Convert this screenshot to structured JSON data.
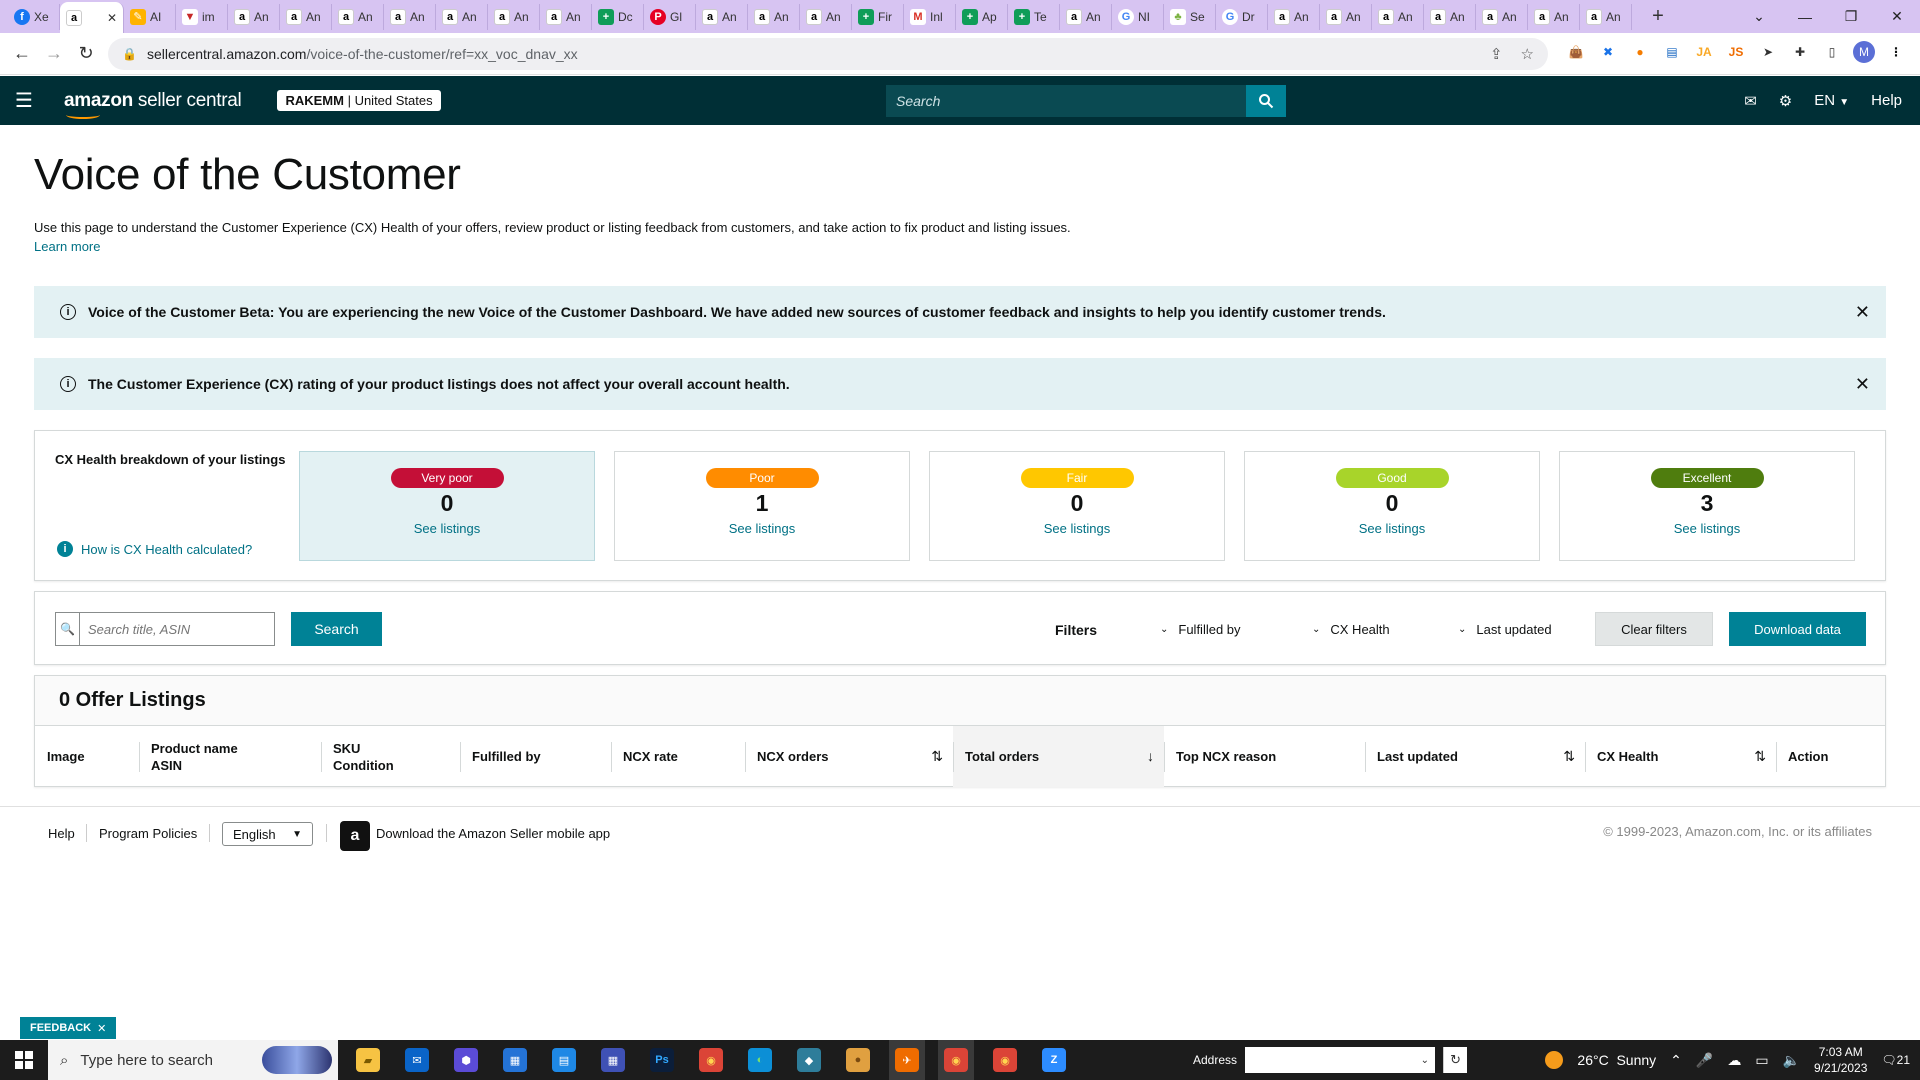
{
  "browser": {
    "tabs": [
      {
        "fav": "fb",
        "glyph": "f",
        "label": "Xe"
      },
      {
        "fav": "a",
        "glyph": "a",
        "label": "",
        "active": true
      },
      {
        "fav": "pen",
        "glyph": "✎",
        "label": "AI"
      },
      {
        "fav": "v",
        "glyph": "▼",
        "label": "im"
      },
      {
        "fav": "a",
        "glyph": "a",
        "label": "An"
      },
      {
        "fav": "a",
        "glyph": "a",
        "label": "An"
      },
      {
        "fav": "a",
        "glyph": "a",
        "label": "An"
      },
      {
        "fav": "a",
        "glyph": "a",
        "label": "An"
      },
      {
        "fav": "a",
        "glyph": "a",
        "label": "An"
      },
      {
        "fav": "a",
        "glyph": "a",
        "label": "An"
      },
      {
        "fav": "a",
        "glyph": "a",
        "label": "An"
      },
      {
        "fav": "sheet",
        "glyph": "+",
        "label": "Dc"
      },
      {
        "fav": "pin",
        "glyph": "P",
        "label": "Gl"
      },
      {
        "fav": "a",
        "glyph": "a",
        "label": "An"
      },
      {
        "fav": "a",
        "glyph": "a",
        "label": "An"
      },
      {
        "fav": "a",
        "glyph": "a",
        "label": "An"
      },
      {
        "fav": "sheet",
        "glyph": "+",
        "label": "Fir"
      },
      {
        "fav": "gm",
        "glyph": "M",
        "label": "Inl"
      },
      {
        "fav": "sheet",
        "glyph": "+",
        "label": "Ap"
      },
      {
        "fav": "sheet",
        "glyph": "+",
        "label": "Te"
      },
      {
        "fav": "a",
        "glyph": "a",
        "label": "An"
      },
      {
        "fav": "g",
        "glyph": "G",
        "label": "NI"
      },
      {
        "fav": "leaf",
        "glyph": "♣",
        "label": "Se"
      },
      {
        "fav": "g",
        "glyph": "G",
        "label": "Dr"
      },
      {
        "fav": "a",
        "glyph": "a",
        "label": "An"
      },
      {
        "fav": "a",
        "glyph": "a",
        "label": "An"
      },
      {
        "fav": "a",
        "glyph": "a",
        "label": "An"
      },
      {
        "fav": "a",
        "glyph": "a",
        "label": "An"
      },
      {
        "fav": "a",
        "glyph": "a",
        "label": "An"
      },
      {
        "fav": "a",
        "glyph": "a",
        "label": "An"
      },
      {
        "fav": "a",
        "glyph": "a",
        "label": "An"
      }
    ],
    "url_host": "sellercentral.amazon.com",
    "url_path": "/voice-of-the-customer/ref=xx_voc_dnav_xx",
    "profile_initial": "M",
    "extensions": [
      {
        "name": "bag",
        "glyph": "👜",
        "color": "#c47a2c"
      },
      {
        "name": "x-circle",
        "glyph": "✖",
        "color": "#1a73e8"
      },
      {
        "name": "orange",
        "glyph": "●",
        "color": "#f57c00"
      },
      {
        "name": "chart",
        "glyph": "▤",
        "color": "#1565c0"
      },
      {
        "name": "ja",
        "glyph": "JA",
        "color": "#f9a825"
      },
      {
        "name": "js",
        "glyph": "JS",
        "color": "#ef6c00"
      },
      {
        "name": "arrow",
        "glyph": "➤",
        "color": "#333"
      },
      {
        "name": "puzzle",
        "glyph": "✚",
        "color": "#333"
      },
      {
        "name": "sidepanel",
        "glyph": "▯",
        "color": "#333"
      }
    ]
  },
  "header": {
    "logo_bold": "amazon",
    "logo_light": " seller central",
    "store_name": "RAKEMM",
    "store_sep": " | ",
    "store_country": "United States",
    "search_placeholder": "Search",
    "language": "EN",
    "help": "Help"
  },
  "page": {
    "title": "Voice of the Customer",
    "intro": "Use this page to understand the Customer Experience (CX) Health of your offers, review product or listing feedback from customers, and take action to fix product and listing issues.",
    "learn_more": "Learn more"
  },
  "alerts": [
    "Voice of the Customer Beta: You are experiencing the new Voice of the Customer Dashboard. We have added new sources of customer feedback and insights to help you identify customer trends.",
    "The Customer Experience (CX) rating of your product listings does not affect your overall account health."
  ],
  "health": {
    "title": "CX Health breakdown of your listings",
    "link": "How is CX Health calculated?",
    "cards": [
      {
        "label": "Very poor",
        "count": "0",
        "link": "See listings",
        "color": "#c40f37",
        "text": "#ffffff",
        "selected": true
      },
      {
        "label": "Poor",
        "count": "1",
        "link": "See listings",
        "color": "#ff8c00",
        "text": "#ffffff",
        "selected": false
      },
      {
        "label": "Fair",
        "count": "0",
        "link": "See listings",
        "color": "#ffc700",
        "text": "#ffffff",
        "selected": false
      },
      {
        "label": "Good",
        "count": "0",
        "link": "See listings",
        "color": "#a8d42a",
        "text": "#ffffff",
        "selected": false
      },
      {
        "label": "Excellent",
        "count": "3",
        "link": "See listings",
        "color": "#4f7d0e",
        "text": "#ffffff",
        "selected": false
      }
    ]
  },
  "filters": {
    "search_placeholder": "Search title, ASIN",
    "search_button": "Search",
    "label": "Filters",
    "selects": [
      "Fulfilled by",
      "CX Health",
      "Last updated"
    ],
    "clear": "Clear filters",
    "download": "Download data"
  },
  "listings": {
    "title": "0 Offer Listings",
    "columns": [
      {
        "l1": "Image",
        "l2": ""
      },
      {
        "l1": "Product name",
        "l2": "ASIN"
      },
      {
        "l1": "SKU",
        "l2": "Condition"
      },
      {
        "l1": "Fulfilled by",
        "l2": ""
      },
      {
        "l1": "NCX rate",
        "l2": ""
      },
      {
        "l1": "NCX orders",
        "l2": "",
        "sort": "⇅"
      },
      {
        "l1": "Total orders",
        "l2": "",
        "sort": "↓",
        "active": true
      },
      {
        "l1": "Top NCX reason",
        "l2": ""
      },
      {
        "l1": "Last updated",
        "l2": "",
        "sort": "⇅"
      },
      {
        "l1": "CX Health",
        "l2": "",
        "sort": "⇅"
      },
      {
        "l1": "Action",
        "l2": ""
      }
    ]
  },
  "footer": {
    "help": "Help",
    "policies": "Program Policies",
    "language": "English",
    "app_text": "Download the Amazon Seller mobile app",
    "copyright": "© 1999-2023, Amazon.com, Inc. or its affiliates"
  },
  "feedback": "FEEDBACK",
  "taskbar": {
    "search_placeholder": "Type here to search",
    "apps": [
      {
        "name": "file-explorer",
        "glyph": "▰",
        "color": "#f6c343",
        "fg": "#7a5a00"
      },
      {
        "name": "mail",
        "glyph": "✉",
        "color": "#0a64c8",
        "fg": "#fff"
      },
      {
        "name": "app-hex",
        "glyph": "⬢",
        "color": "#5b4bd6",
        "fg": "#fff"
      },
      {
        "name": "store",
        "glyph": "▦",
        "color": "#2473d6",
        "fg": "#fff"
      },
      {
        "name": "app-blue",
        "glyph": "▤",
        "color": "#1e88e5",
        "fg": "#fff"
      },
      {
        "name": "calculator",
        "glyph": "▦",
        "color": "#3f51b5",
        "fg": "#fff"
      },
      {
        "name": "photoshop",
        "glyph": "Ps",
        "color": "#0b1e3a",
        "fg": "#31a8ff"
      },
      {
        "name": "chrome",
        "glyph": "◉",
        "color": "#db4437",
        "fg": "#ffd54f"
      },
      {
        "name": "edge",
        "glyph": "◐",
        "color": "#0c8fd6",
        "fg": "#7be06a"
      },
      {
        "name": "app-teal",
        "glyph": "◆",
        "color": "#2e7d9a",
        "fg": "#fff"
      },
      {
        "name": "app-cookie",
        "glyph": "●",
        "color": "#e0a040",
        "fg": "#7a4a10"
      },
      {
        "name": "app-plane",
        "glyph": "✈",
        "color": "#ef6c00",
        "fg": "#fff",
        "hl": true
      },
      {
        "name": "chrome-profile",
        "glyph": "◉",
        "color": "#db4437",
        "fg": "#ffd54f",
        "hl": true
      },
      {
        "name": "chrome-2",
        "glyph": "◉",
        "color": "#db4437",
        "fg": "#ffd54f"
      },
      {
        "name": "zoom",
        "glyph": "Z",
        "color": "#2d8cff",
        "fg": "#fff"
      }
    ],
    "address_label": "Address",
    "weather": "26°C  Sunny",
    "time": "7:03 AM",
    "date": "9/21/2023",
    "notif_count": "21"
  }
}
